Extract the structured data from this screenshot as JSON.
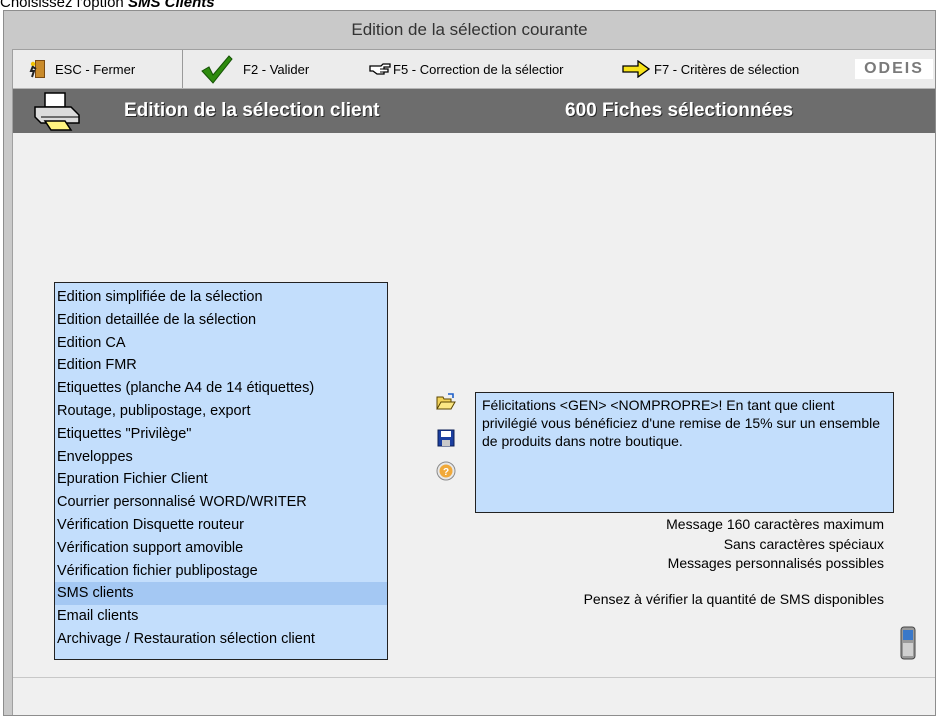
{
  "caption": {
    "prefix": "Choisissez l'option ",
    "emphasis": "SMS Clients"
  },
  "window": {
    "title": "Edition de la sélection courante"
  },
  "toolbar": {
    "esc_label": "ESC - Fermer",
    "f2_label": "F2 - Valider",
    "f5_label": "F5 - Correction de la sélectior",
    "f7_label": "F7 - Critères de sélection",
    "logo_text": "ODEIS"
  },
  "header": {
    "title": "Edition de la sélection client",
    "count": "600 Fiches sélectionnées"
  },
  "list": {
    "items": [
      "Edition simplifiée de la sélection",
      "Edition detaillée de la sélection",
      "Edition CA",
      "Edition FMR",
      "Etiquettes (planche A4 de 14 étiquettes)",
      "Routage, publipostage, export",
      "Etiquettes \"Privilège\"",
      "Enveloppes",
      "Epuration Fichier Client",
      "Courrier personnalisé WORD/WRITER",
      "Vérification Disquette routeur",
      "Vérification support amovible",
      "Vérification fichier publipostage",
      "SMS clients",
      "Email clients",
      "Archivage /  Restauration sélection client"
    ],
    "selected": "SMS clients"
  },
  "message": {
    "text": "Félicitations <GEN> <NOMPROPRE>! En tant que client privilégié vous bénéficiez d'une remise de 15% sur un ensemble de produits dans notre boutique."
  },
  "notes": {
    "line1": "Message 160 caractères maximum",
    "line2": "Sans caractères spéciaux",
    "line3": "Messages personnalisés possibles",
    "reminder": "Pensez à vérifier la quantité de SMS disponibles"
  },
  "icons": {
    "esc": "door-exit-icon",
    "f2": "check-icon",
    "f5": "pointing-hand-icon",
    "f7": "arrow-right-icon",
    "header": "printer-icon",
    "open": "folder-open-icon",
    "save": "floppy-save-icon",
    "help": "question-icon",
    "phone": "mobile-phone-icon"
  },
  "colors": {
    "list_bg": "#c3defc",
    "list_selected": "#a4c8f3",
    "header_bg": "#6d6d6d",
    "check": "#2e8b0e"
  }
}
